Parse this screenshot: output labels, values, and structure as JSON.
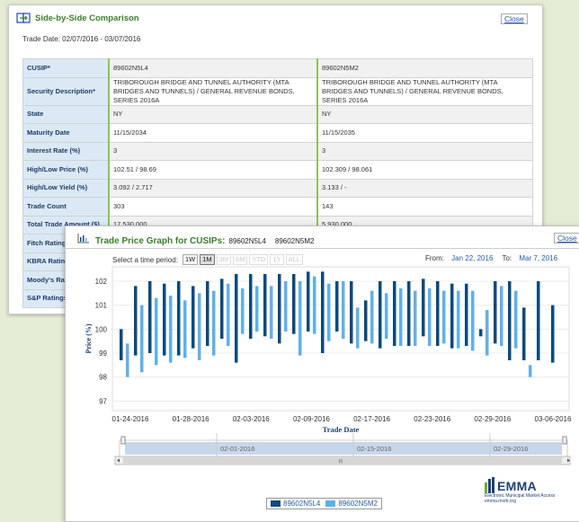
{
  "comparison": {
    "title": "Side-by-Side Comparison",
    "close_label": "Close",
    "trade_date": "Trade Date: 02/07/2016 - 03/07/2016",
    "rows": [
      {
        "label": "CUSIP*",
        "v1": "89602N5L4",
        "v2": "89602N5M2"
      },
      {
        "label": "Security Description*",
        "v1": "TRIBOROUGH BRIDGE AND TUNNEL AUTHORITY (MTA BRIDGES AND TUNNELS) / GENERAL REVENUE BONDS, SERIES 2016A",
        "v2": "TRIBOROUGH BRIDGE AND TUNNEL AUTHORITY (MTA BRIDGES AND TUNNELS) / GENERAL REVENUE BONDS, SERIES 2016A"
      },
      {
        "label": "State",
        "v1": "NY",
        "v2": "NY"
      },
      {
        "label": "Maturity Date",
        "v1": "11/15/2034",
        "v2": "11/15/2035"
      },
      {
        "label": "Interest Rate (%)",
        "v1": "3",
        "v2": "3"
      },
      {
        "label": "High/Low Price (%)",
        "v1": "102.51 / 98.69",
        "v2": "102.309 / 98.061"
      },
      {
        "label": "High/Low Yield (%)",
        "v1": "3.092 / 2.717",
        "v2": "3.133 / -"
      },
      {
        "label": "Trade Count",
        "v1": "303",
        "v2": "143"
      },
      {
        "label": "Total Trade Amount ($)",
        "v1": "17,530,000",
        "v2": "5,930,000"
      },
      {
        "label": "Fitch Ratings",
        "v1": "",
        "v2": ""
      },
      {
        "label": "KBRA Ratings",
        "v1": "",
        "v2": ""
      },
      {
        "label": "Moody's Ratings",
        "v1": "",
        "v2": ""
      },
      {
        "label": "S&P Ratings",
        "v1": "",
        "v2": ""
      }
    ]
  },
  "graph": {
    "title": "Trade Price Graph for CUSIPs:",
    "cusip1": "89602N5L4",
    "cusip2": "89602N5M2",
    "close_label": "Close",
    "period_label": "Select a time period:",
    "periods": [
      {
        "label": "1W",
        "state": "normal"
      },
      {
        "label": "1M",
        "state": "selected"
      },
      {
        "label": "3M",
        "state": "disabled"
      },
      {
        "label": "6M",
        "state": "disabled"
      },
      {
        "label": "YTD",
        "state": "disabled"
      },
      {
        "label": "1Y",
        "state": "disabled"
      },
      {
        "label": "ALL",
        "state": "disabled"
      }
    ],
    "from_label": "From:",
    "from_value": "Jan 22, 2016",
    "to_label": "To:",
    "to_value": "Mar 7, 2016",
    "navigator_labels": [
      "02-01-2016",
      "02-15-2016",
      "02-29-2016"
    ],
    "navigator_scroll_glyph": "III",
    "emma_logo": "EMMA",
    "emma_tagline": "Electronic Municipal Market Access",
    "emma_site": "emma.msrb.org"
  },
  "chart_data": {
    "type": "bar",
    "subtype": "floating-range",
    "xlabel": "Trade Date",
    "ylabel": "Price (%)",
    "ylim": [
      97,
      102.5
    ],
    "yticks": [
      97,
      98,
      99,
      100,
      101,
      102
    ],
    "x_tick_labels": [
      "01-24-2016",
      "01-28-2016",
      "02-03-2016",
      "02-09-2016",
      "02-17-2016",
      "02-23-2016",
      "02-29-2016",
      "03-06-2016"
    ],
    "colors": {
      "series1": "#0b4a7e",
      "series2": "#60b0ea"
    },
    "series": [
      {
        "name": "89602N5L4",
        "ranges": [
          [
            98.7,
            100.0
          ],
          [
            98.9,
            101.8
          ],
          [
            99.0,
            102.0
          ],
          [
            98.9,
            101.9
          ],
          [
            98.9,
            102.0
          ],
          [
            99.2,
            101.8
          ],
          [
            99.3,
            102.0
          ],
          [
            99.6,
            102.1
          ],
          [
            98.6,
            102.3
          ],
          [
            99.6,
            102.3
          ],
          [
            99.7,
            102.3
          ],
          [
            99.4,
            102.3
          ],
          [
            99.8,
            102.3
          ],
          [
            99.9,
            102.4
          ],
          [
            99.0,
            102.4
          ],
          [
            99.9,
            102.0
          ],
          [
            99.4,
            102.0
          ],
          [
            99.5,
            101.2
          ],
          [
            99.2,
            102.0
          ],
          [
            99.3,
            102.0
          ],
          [
            99.3,
            102.0
          ],
          [
            99.7,
            102.1
          ],
          [
            99.3,
            102.0
          ],
          [
            99.2,
            101.9
          ],
          [
            99.3,
            101.9
          ],
          [
            99.7,
            100.0
          ],
          [
            99.4,
            102.0
          ],
          [
            98.7,
            102.0
          ],
          [
            98.7,
            100.9
          ],
          [
            98.7,
            102.0
          ],
          [
            98.6,
            101.0
          ]
        ]
      },
      {
        "name": "89602N5M2",
        "ranges": [
          [
            98.0,
            99.4
          ],
          [
            98.2,
            101.0
          ],
          [
            98.5,
            101.3
          ],
          [
            98.6,
            101.4
          ],
          [
            98.8,
            101.2
          ],
          [
            98.7,
            101.5
          ],
          [
            98.9,
            101.6
          ],
          [
            99.3,
            101.9
          ],
          [
            99.8,
            101.7
          ],
          [
            99.9,
            101.8
          ],
          [
            99.6,
            101.8
          ],
          [
            99.9,
            102.0
          ],
          [
            98.9,
            102.0
          ],
          [
            99.8,
            102.2
          ],
          [
            99.5,
            101.9
          ],
          [
            99.6,
            102.0
          ],
          [
            99.2,
            100.9
          ],
          [
            99.4,
            101.6
          ],
          [
            99.6,
            101.5
          ],
          [
            99.3,
            101.7
          ],
          [
            99.3,
            101.6
          ],
          [
            99.3,
            101.7
          ],
          [
            99.4,
            101.6
          ],
          [
            99.2,
            101.6
          ],
          [
            99.1,
            101.6
          ],
          [
            98.9,
            100.8
          ],
          [
            99.3,
            101.8
          ],
          [
            99.2,
            101.6
          ],
          [
            98.0,
            98.5
          ]
        ]
      }
    ]
  }
}
